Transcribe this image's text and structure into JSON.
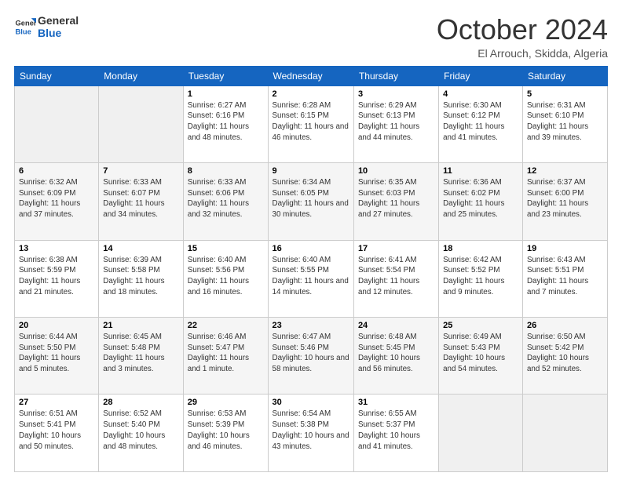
{
  "header": {
    "logo_line1": "General",
    "logo_line2": "Blue",
    "month": "October 2024",
    "location": "El Arrouch, Skidda, Algeria"
  },
  "days_of_week": [
    "Sunday",
    "Monday",
    "Tuesday",
    "Wednesday",
    "Thursday",
    "Friday",
    "Saturday"
  ],
  "weeks": [
    [
      {
        "day": "",
        "info": ""
      },
      {
        "day": "",
        "info": ""
      },
      {
        "day": "1",
        "info": "Sunrise: 6:27 AM\nSunset: 6:16 PM\nDaylight: 11 hours and 48 minutes."
      },
      {
        "day": "2",
        "info": "Sunrise: 6:28 AM\nSunset: 6:15 PM\nDaylight: 11 hours and 46 minutes."
      },
      {
        "day": "3",
        "info": "Sunrise: 6:29 AM\nSunset: 6:13 PM\nDaylight: 11 hours and 44 minutes."
      },
      {
        "day": "4",
        "info": "Sunrise: 6:30 AM\nSunset: 6:12 PM\nDaylight: 11 hours and 41 minutes."
      },
      {
        "day": "5",
        "info": "Sunrise: 6:31 AM\nSunset: 6:10 PM\nDaylight: 11 hours and 39 minutes."
      }
    ],
    [
      {
        "day": "6",
        "info": "Sunrise: 6:32 AM\nSunset: 6:09 PM\nDaylight: 11 hours and 37 minutes."
      },
      {
        "day": "7",
        "info": "Sunrise: 6:33 AM\nSunset: 6:07 PM\nDaylight: 11 hours and 34 minutes."
      },
      {
        "day": "8",
        "info": "Sunrise: 6:33 AM\nSunset: 6:06 PM\nDaylight: 11 hours and 32 minutes."
      },
      {
        "day": "9",
        "info": "Sunrise: 6:34 AM\nSunset: 6:05 PM\nDaylight: 11 hours and 30 minutes."
      },
      {
        "day": "10",
        "info": "Sunrise: 6:35 AM\nSunset: 6:03 PM\nDaylight: 11 hours and 27 minutes."
      },
      {
        "day": "11",
        "info": "Sunrise: 6:36 AM\nSunset: 6:02 PM\nDaylight: 11 hours and 25 minutes."
      },
      {
        "day": "12",
        "info": "Sunrise: 6:37 AM\nSunset: 6:00 PM\nDaylight: 11 hours and 23 minutes."
      }
    ],
    [
      {
        "day": "13",
        "info": "Sunrise: 6:38 AM\nSunset: 5:59 PM\nDaylight: 11 hours and 21 minutes."
      },
      {
        "day": "14",
        "info": "Sunrise: 6:39 AM\nSunset: 5:58 PM\nDaylight: 11 hours and 18 minutes."
      },
      {
        "day": "15",
        "info": "Sunrise: 6:40 AM\nSunset: 5:56 PM\nDaylight: 11 hours and 16 minutes."
      },
      {
        "day": "16",
        "info": "Sunrise: 6:40 AM\nSunset: 5:55 PM\nDaylight: 11 hours and 14 minutes."
      },
      {
        "day": "17",
        "info": "Sunrise: 6:41 AM\nSunset: 5:54 PM\nDaylight: 11 hours and 12 minutes."
      },
      {
        "day": "18",
        "info": "Sunrise: 6:42 AM\nSunset: 5:52 PM\nDaylight: 11 hours and 9 minutes."
      },
      {
        "day": "19",
        "info": "Sunrise: 6:43 AM\nSunset: 5:51 PM\nDaylight: 11 hours and 7 minutes."
      }
    ],
    [
      {
        "day": "20",
        "info": "Sunrise: 6:44 AM\nSunset: 5:50 PM\nDaylight: 11 hours and 5 minutes."
      },
      {
        "day": "21",
        "info": "Sunrise: 6:45 AM\nSunset: 5:48 PM\nDaylight: 11 hours and 3 minutes."
      },
      {
        "day": "22",
        "info": "Sunrise: 6:46 AM\nSunset: 5:47 PM\nDaylight: 11 hours and 1 minute."
      },
      {
        "day": "23",
        "info": "Sunrise: 6:47 AM\nSunset: 5:46 PM\nDaylight: 10 hours and 58 minutes."
      },
      {
        "day": "24",
        "info": "Sunrise: 6:48 AM\nSunset: 5:45 PM\nDaylight: 10 hours and 56 minutes."
      },
      {
        "day": "25",
        "info": "Sunrise: 6:49 AM\nSunset: 5:43 PM\nDaylight: 10 hours and 54 minutes."
      },
      {
        "day": "26",
        "info": "Sunrise: 6:50 AM\nSunset: 5:42 PM\nDaylight: 10 hours and 52 minutes."
      }
    ],
    [
      {
        "day": "27",
        "info": "Sunrise: 6:51 AM\nSunset: 5:41 PM\nDaylight: 10 hours and 50 minutes."
      },
      {
        "day": "28",
        "info": "Sunrise: 6:52 AM\nSunset: 5:40 PM\nDaylight: 10 hours and 48 minutes."
      },
      {
        "day": "29",
        "info": "Sunrise: 6:53 AM\nSunset: 5:39 PM\nDaylight: 10 hours and 46 minutes."
      },
      {
        "day": "30",
        "info": "Sunrise: 6:54 AM\nSunset: 5:38 PM\nDaylight: 10 hours and 43 minutes."
      },
      {
        "day": "31",
        "info": "Sunrise: 6:55 AM\nSunset: 5:37 PM\nDaylight: 10 hours and 41 minutes."
      },
      {
        "day": "",
        "info": ""
      },
      {
        "day": "",
        "info": ""
      }
    ]
  ]
}
